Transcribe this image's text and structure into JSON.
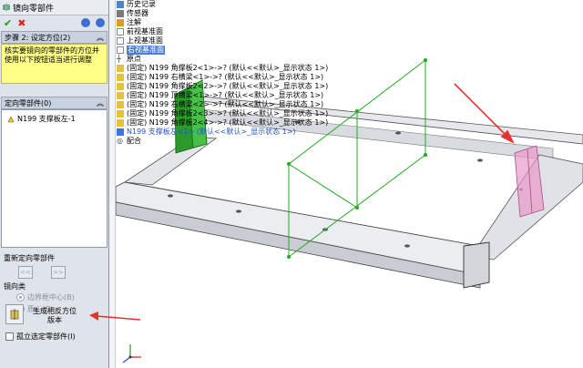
{
  "panel": {
    "title": "镜向零部件",
    "step": {
      "title": "步骤 2: 设定方位(2)",
      "message": "核实要镜向的零部件的方位并使用以下按钮适当进行调整"
    },
    "list": {
      "title": "定向零部件(0)",
      "items": [
        {
          "label": "N199 支撑板左-1"
        }
      ]
    },
    "reorient": {
      "label": "重新定向零部件",
      "prev": "<<",
      "next": ">>"
    },
    "mirror_type": {
      "label": "镜向类",
      "options": [
        {
          "label": "边界框中心(B)",
          "selected": true
        },
        {
          "label": "质心(C)",
          "selected": false
        }
      ]
    },
    "generate": {
      "label": "生成相反方位\n版本"
    },
    "isolate": {
      "label": "孤立选定零部件(I)"
    }
  },
  "tree": {
    "items": [
      {
        "label": "历史记录",
        "icon": "history-icon"
      },
      {
        "label": "传感器",
        "icon": "sensor-icon"
      },
      {
        "label": "注解",
        "icon": "annotation-icon"
      },
      {
        "label": "前视基准面",
        "icon": "plane-icon"
      },
      {
        "label": "上视基准面",
        "icon": "plane-icon"
      },
      {
        "label": "右视基准面",
        "icon": "plane-icon"
      },
      {
        "label": "原点",
        "icon": "origin-icon"
      },
      {
        "label": "(固定) N199 角撑板2<1>->? (默认<<默认>_显示状态 1>)",
        "icon": "part-icon"
      },
      {
        "label": "(固定) N199 右横梁<1>->? (默认<<默认>_显示状态 1>)",
        "icon": "part-icon"
      },
      {
        "label": "(固定) N199 角撑板2<2>->? (默认<<默认>_显示状态 1>)",
        "icon": "part-icon"
      },
      {
        "label": "(固定) N199 顶横梁<1>->? (默认<<默认>_显示状态 1>)",
        "icon": "part-icon"
      },
      {
        "label": "(固定) N199 右横梁<2>->? (默认<<默认>_显示状态 1>)",
        "icon": "part-icon"
      },
      {
        "label": "(固定) N199 角撑板2<3>->? (默认<<默认>_显示状态 1>)",
        "icon": "part-icon"
      },
      {
        "label": "(固定) N199 角撑板2<4>->? (默认<<默认>_显示状态 1>)",
        "icon": "part-icon"
      },
      {
        "label": "N199 支撑板左<1> (默认<<默认>_显示状态 1>)",
        "icon": "part-icon"
      },
      {
        "label": "配合",
        "icon": "mate-icon"
      }
    ]
  },
  "colors": {
    "panel_bg": "#dfe3ea",
    "message_bg": "#ffff88",
    "accent_red": "#e8312f",
    "frame_green": "#22aa22",
    "mirror_pink": "#e89ac8"
  }
}
